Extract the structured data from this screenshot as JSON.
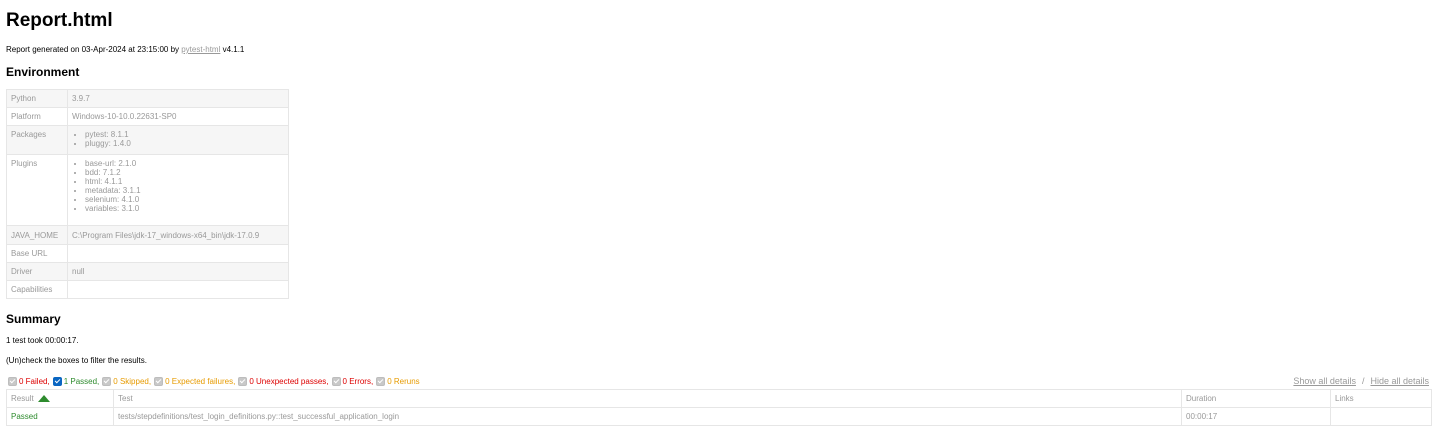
{
  "title": "Report.html",
  "generated": {
    "prefix": "Report generated on 03-Apr-2024 at 23:15:00 by ",
    "link": "pytest-html",
    "suffix": " v4.1.1"
  },
  "environment": {
    "heading": "Environment",
    "rows": {
      "python": {
        "key": "Python",
        "value": "3.9.7"
      },
      "platform": {
        "key": "Platform",
        "value": "Windows-10-10.0.22631-SP0"
      },
      "packages": {
        "key": "Packages",
        "items": [
          "pytest: 8.1.1",
          "pluggy: 1.4.0"
        ]
      },
      "plugins": {
        "key": "Plugins",
        "items": [
          "base-url: 2.1.0",
          "bdd: 7.1.2",
          "html: 4.1.1",
          "metadata: 3.1.1",
          "selenium: 4.1.0",
          "variables: 3.1.0"
        ]
      },
      "java_home": {
        "key": "JAVA_HOME",
        "value": "C:\\Program Files\\jdk-17_windows-x64_bin\\jdk-17.0.9"
      },
      "base_url": {
        "key": "Base URL",
        "value": ""
      },
      "driver": {
        "key": "Driver",
        "value": "null"
      },
      "capabilities": {
        "key": "Capabilities",
        "value": ""
      }
    }
  },
  "summary": {
    "heading": "Summary",
    "took": "1 test took 00:00:17.",
    "hint": "(Un)check the boxes to filter the results."
  },
  "filters": {
    "failed": "0 Failed,",
    "passed": "1 Passed,",
    "skipped": "0 Skipped,",
    "xfailed": "0 Expected failures,",
    "xpassed": "0 Unexpected passes,",
    "errors": "0 Errors,",
    "reruns": "0 Reruns"
  },
  "details": {
    "show": "Show all details",
    "separator": "/",
    "hide": "Hide all details"
  },
  "results": {
    "columns": {
      "result": "Result",
      "test": "Test",
      "duration": "Duration",
      "links": "Links"
    },
    "rows": [
      {
        "result": "Passed",
        "test": "tests/stepdefinitions/test_login_definitions.py::test_successful_application_login",
        "duration": "00:00:17",
        "links": ""
      }
    ]
  },
  "colors": {
    "passed": "#2e8b2e",
    "failed": "#dd0000",
    "skipped": "#e79b00",
    "checkbox_on": "#0a66c2"
  }
}
